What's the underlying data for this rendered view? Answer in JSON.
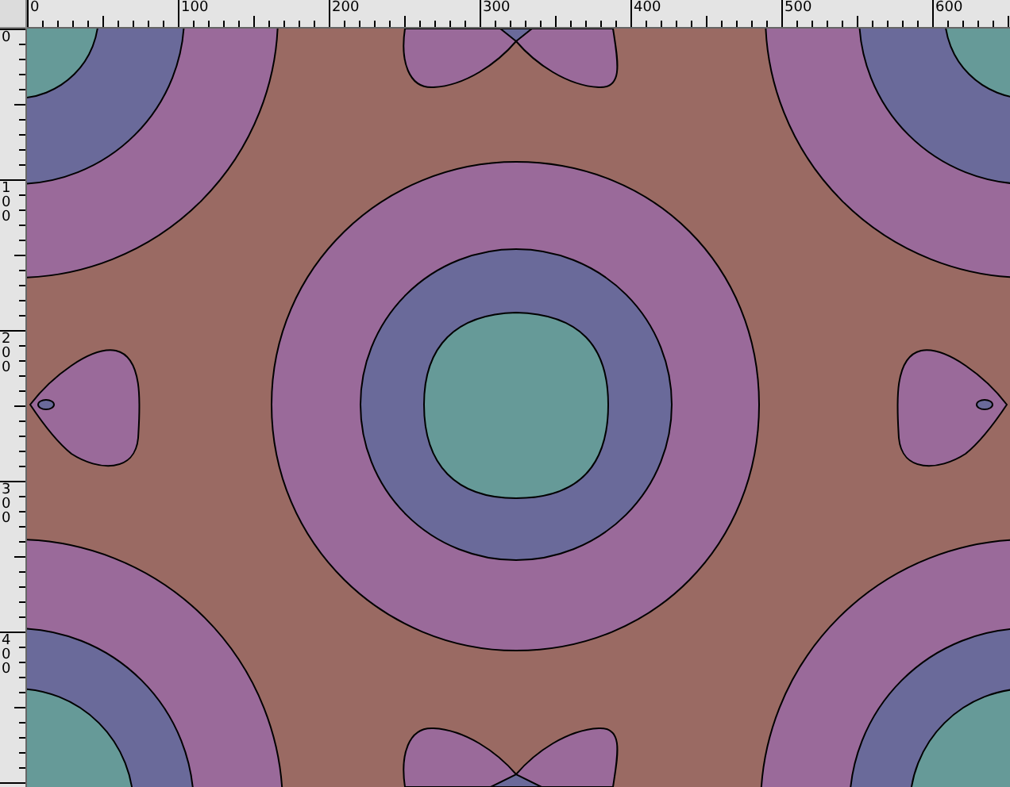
{
  "rulers": {
    "horizontal": [
      "0",
      "100",
      "200",
      "300",
      "400",
      "500",
      "600"
    ],
    "vertical": [
      "0",
      "100",
      "200",
      "300",
      "400"
    ]
  }
}
